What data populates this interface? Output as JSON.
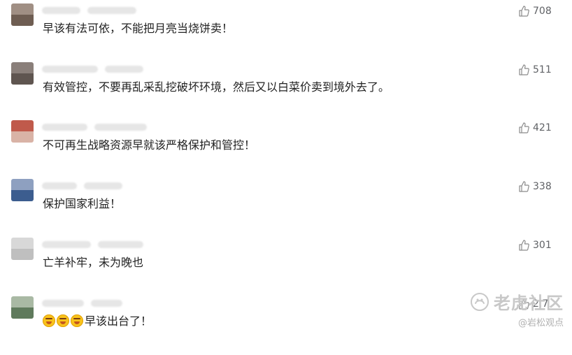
{
  "comments": [
    {
      "text": "早该有法可依，不能把月亮当烧饼卖！",
      "likes": "708",
      "avatar_colors": [
        "#a08f84",
        "#6e5d52"
      ]
    },
    {
      "text": "有效管控，不要再乱采乱挖破坏环境，然后又以白菜价卖到境外去了。",
      "likes": "511",
      "avatar_colors": [
        "#8a7f7a",
        "#5f5550"
      ]
    },
    {
      "text": "不可再生战略资源早就该严格保护和管控！",
      "likes": "421",
      "avatar_colors": [
        "#c05a4b",
        "#d9b3a6"
      ]
    },
    {
      "text": "保护国家利益！",
      "likes": "338",
      "avatar_colors": [
        "#8ea0c0",
        "#3c5d8f"
      ]
    },
    {
      "text": "亡羊补牢，未为晚也",
      "likes": "301",
      "avatar_colors": [
        "#d8d8d8",
        "#bfbfbf"
      ]
    },
    {
      "text": "早该出台了！",
      "likes": "2.7",
      "avatar_colors": [
        "#a9b9a4",
        "#5f7a5c"
      ]
    }
  ],
  "watermark": {
    "title": "老虎社区",
    "subtitle": "@岩松观点"
  },
  "icons": {
    "like": "thumbs-up-icon",
    "emoji": "laughing-emoji-icon",
    "logo": "tiger-community-logo-icon"
  }
}
